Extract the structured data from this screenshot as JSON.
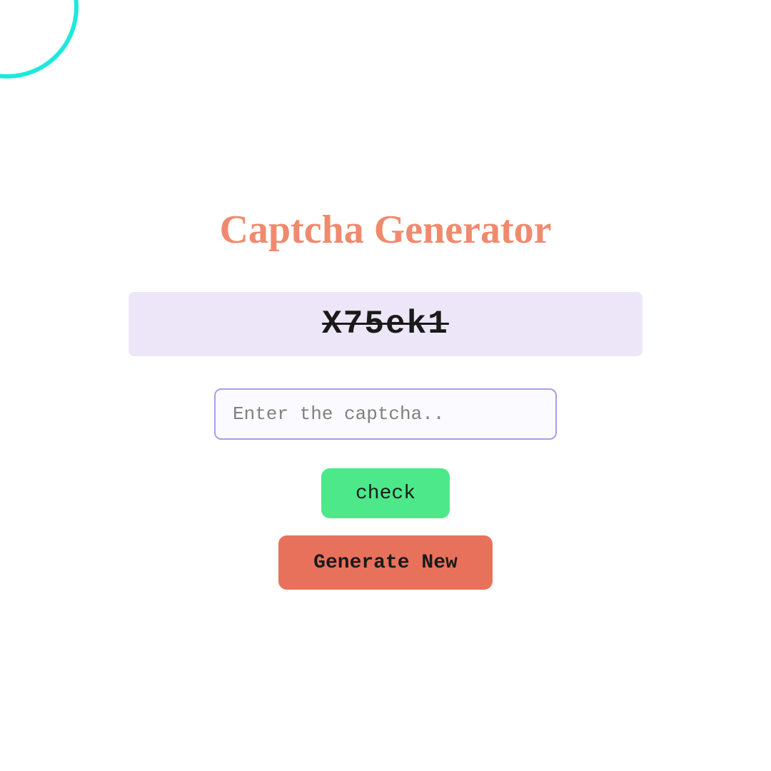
{
  "header": {
    "title": "Captcha Generator"
  },
  "captcha": {
    "value": "X75ek1"
  },
  "input": {
    "placeholder": "Enter the captcha.."
  },
  "buttons": {
    "check_label": "check",
    "generate_label": "Generate New"
  },
  "colors": {
    "accent_circle": "#1de9d9",
    "title": "#f08a6e",
    "captcha_bg": "#ede6f8",
    "input_border": "#a89ee8",
    "check_bg": "#4de88a",
    "generate_bg": "#e8715c"
  }
}
